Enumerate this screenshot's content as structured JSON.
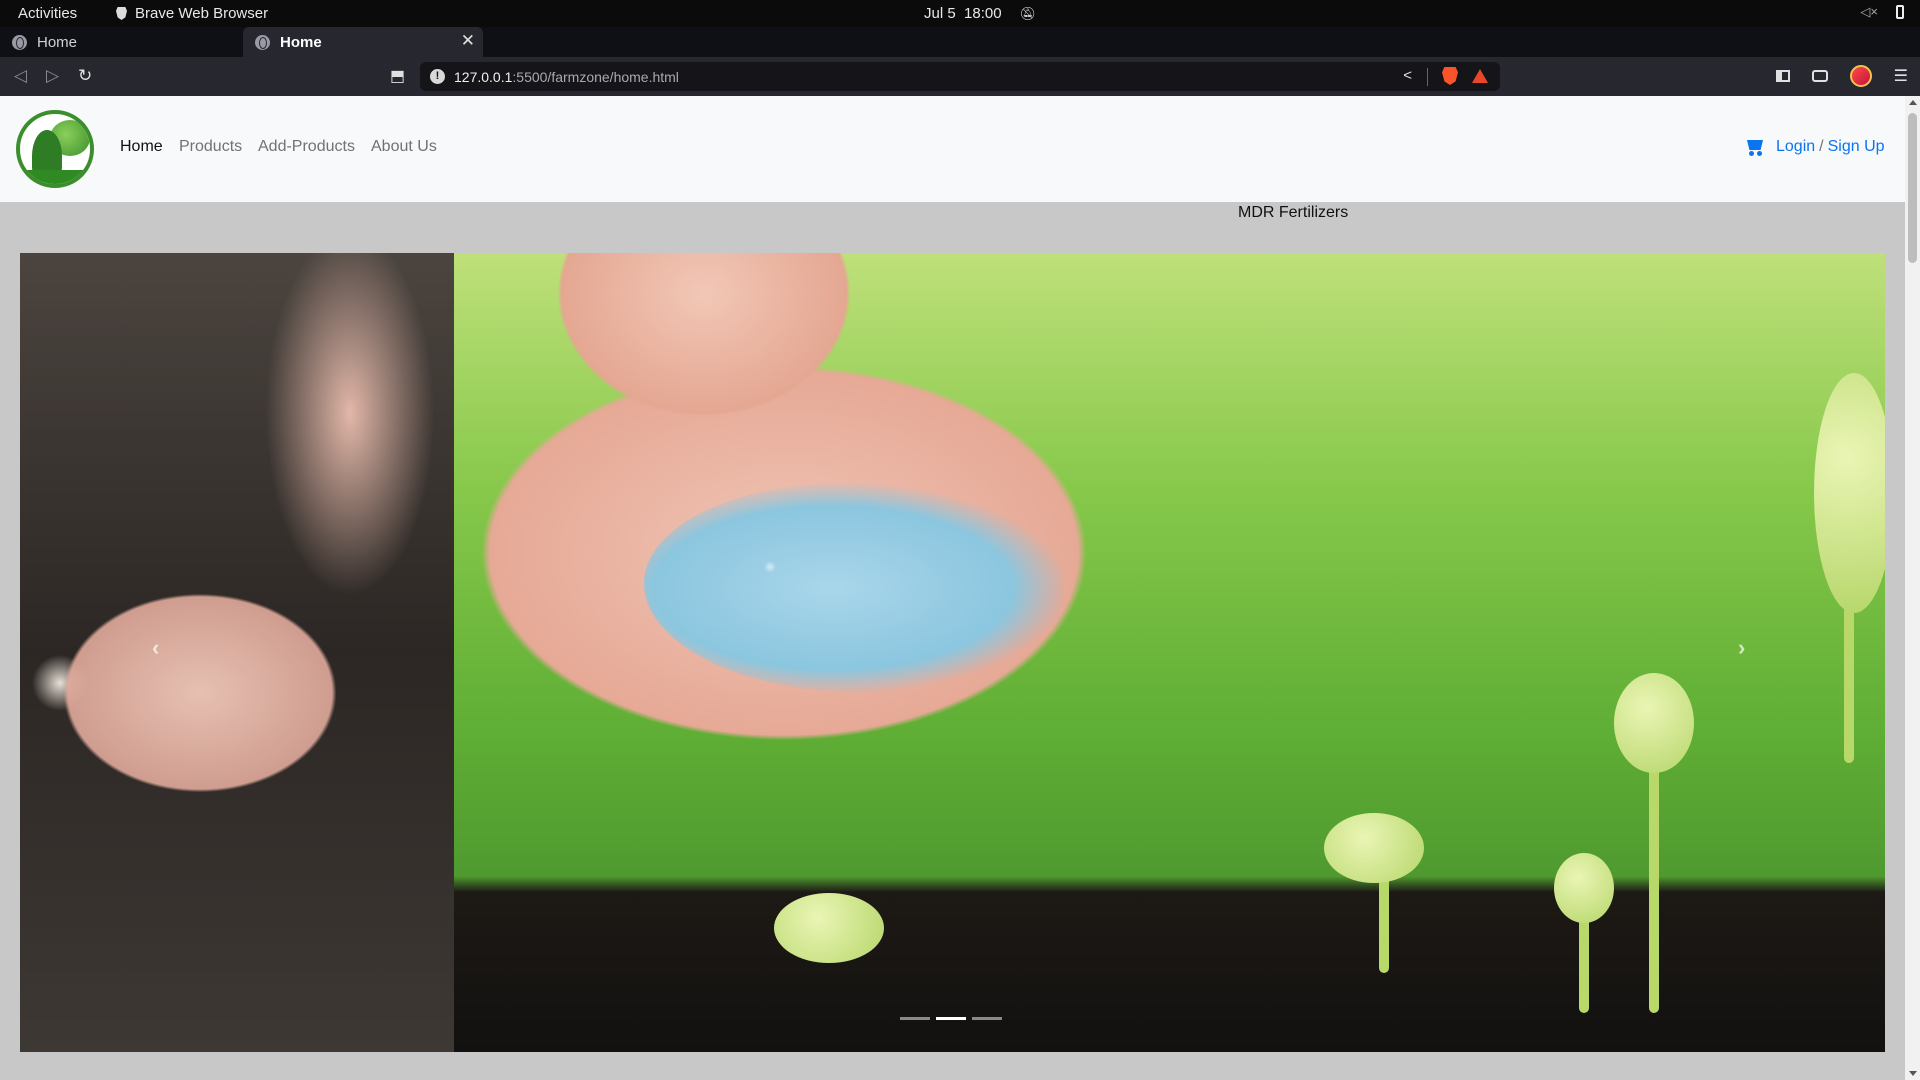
{
  "os_bar": {
    "activities": "Activities",
    "app_name": "Brave Web Browser",
    "date": "Jul 5",
    "time": "18:00"
  },
  "tabs": [
    {
      "title": "Home",
      "active": false
    },
    {
      "title": "Home",
      "active": true
    }
  ],
  "tab_controls": {
    "close_glyph": "✕",
    "new_tab_glyph": "+",
    "tab_menu_glyph": "⌄"
  },
  "toolbar": {
    "back_glyph": "◁",
    "forward_glyph": "▷",
    "reload_glyph": "↻",
    "bookmark_glyph": "⬒",
    "url_host": "127.0.0.1",
    "url_rest": ":5500/farmzone/home.html"
  },
  "site": {
    "nav": {
      "home": "Home",
      "products": "Products",
      "add_products": "Add-Products",
      "about": "About Us"
    },
    "auth": {
      "login": "Login",
      "separator": "/",
      "signup": "Sign Up"
    },
    "brand_text": "MDR Fertilizers",
    "carousel": {
      "slide_count": 3,
      "active_index": 1,
      "prev_glyph": "‹",
      "next_glyph": "›"
    }
  },
  "colors": {
    "link_blue": "#0b74f1",
    "navbar_bg": "#f8f9fa",
    "page_bg": "#c8c8c8"
  },
  "icons": {
    "cart": "shopping-cart-icon",
    "logo": "farm-logo"
  }
}
